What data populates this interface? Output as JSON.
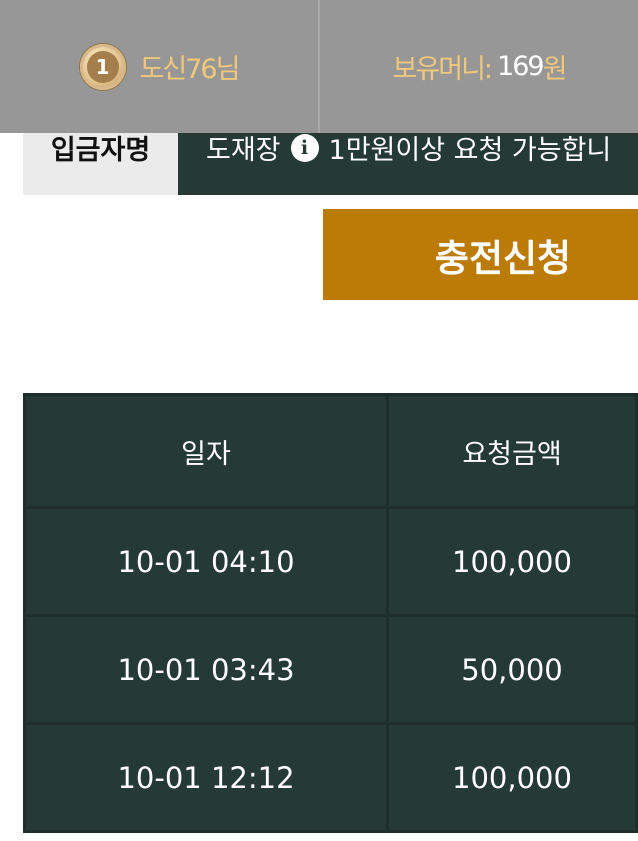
{
  "header": {
    "level": "1",
    "user_name": "도신76님",
    "money_label": "보유머니: ",
    "money_value": "169",
    "money_unit": "원"
  },
  "depositor": {
    "label": "입금자명",
    "name": "도재장",
    "notice": "1만원이상 요청 가능합니"
  },
  "charge_button_label": "충전신청",
  "history": {
    "headers": [
      "일자",
      "요청금액"
    ],
    "rows": [
      {
        "date": "10-01 04:10",
        "amount": "100,000"
      },
      {
        "date": "10-01 03:43",
        "amount": "50,000"
      },
      {
        "date": "10-01 12:12",
        "amount": "100,000"
      }
    ]
  },
  "colors": {
    "topbar": "#979797",
    "accent_gold": "#f0c87a",
    "dark_green": "#253935",
    "button_orange": "#bc7b07"
  }
}
